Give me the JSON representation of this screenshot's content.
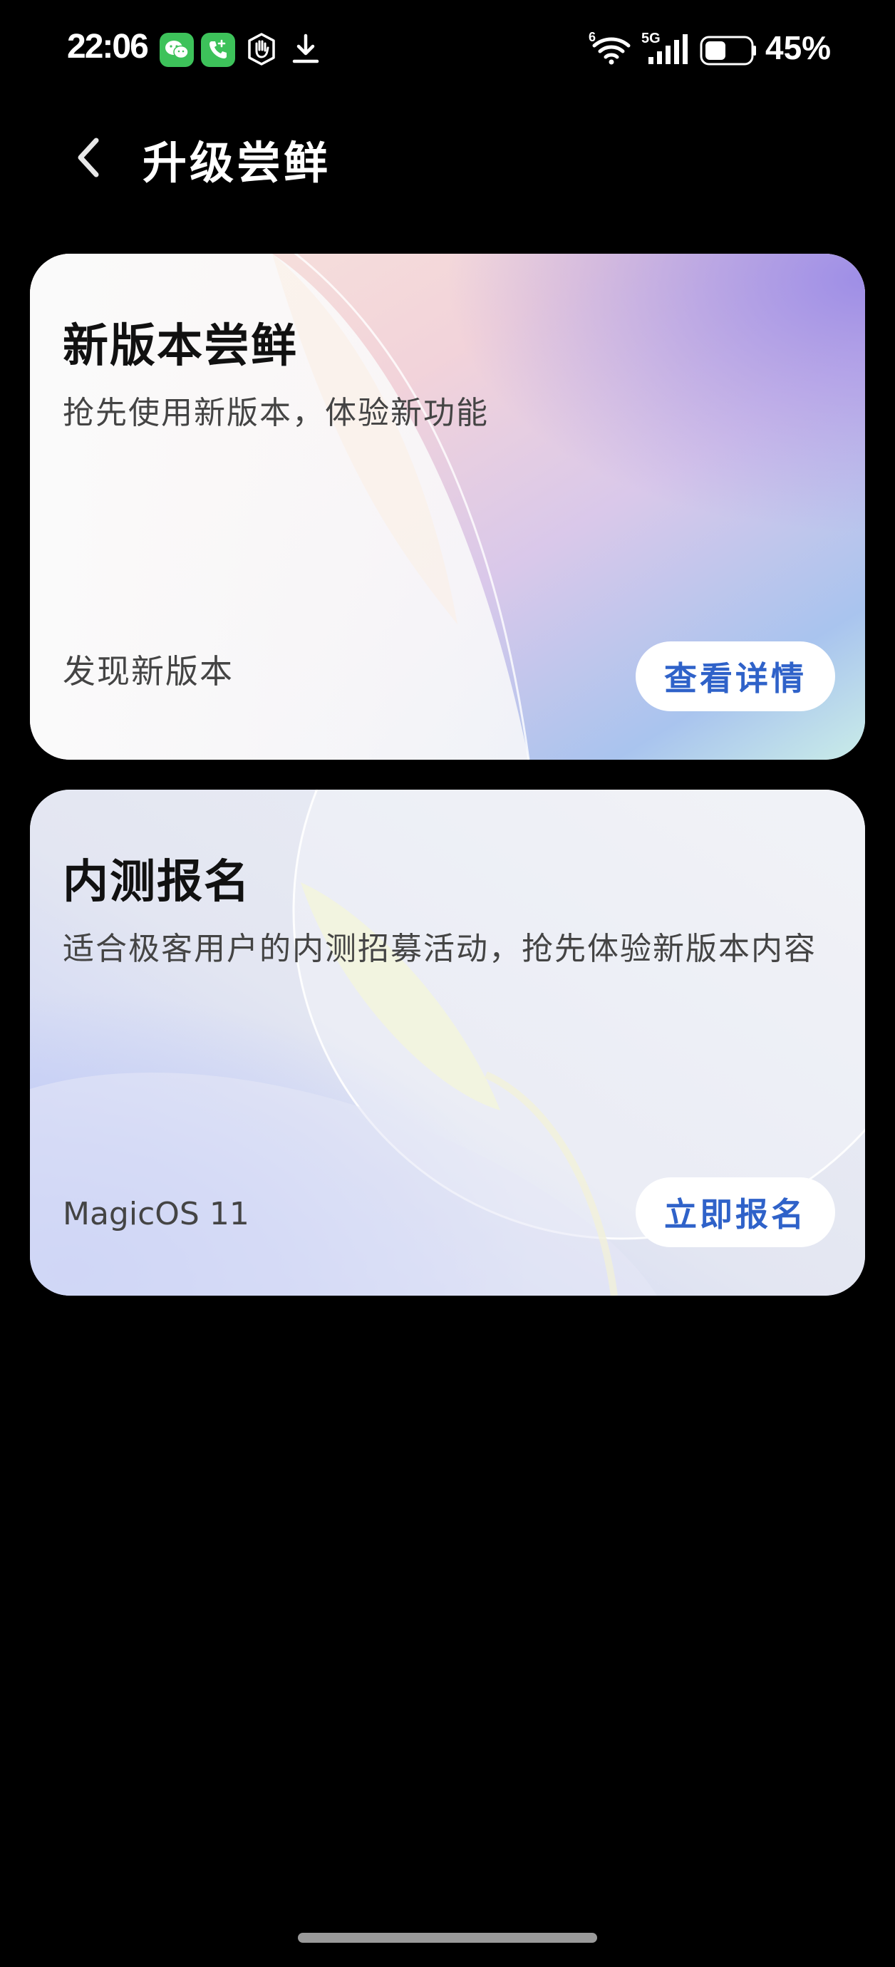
{
  "status_bar": {
    "time": "22:06",
    "battery_percent": "45%",
    "battery_level": 0.45,
    "network_label": "5G",
    "wifi_label": "6",
    "icons": [
      "wechat-icon",
      "phone-call-icon",
      "hand-icon",
      "download-icon",
      "wifi-icon",
      "signal-icon",
      "battery-icon"
    ]
  },
  "header": {
    "title": "升级尝鲜",
    "back_icon": "chevron-left-icon"
  },
  "cards": [
    {
      "title": "新版本尝鲜",
      "description": "抢先使用新版本，体验新功能",
      "footer": "发现新版本",
      "button_label": "查看详情"
    },
    {
      "title": "内测报名",
      "description": "适合极客用户的内测招募活动，抢先体验新版本内容",
      "footer": "MagicOS 11",
      "button_label": "立即报名"
    }
  ],
  "colors": {
    "accent": "#2f62c9",
    "background": "#000000"
  }
}
